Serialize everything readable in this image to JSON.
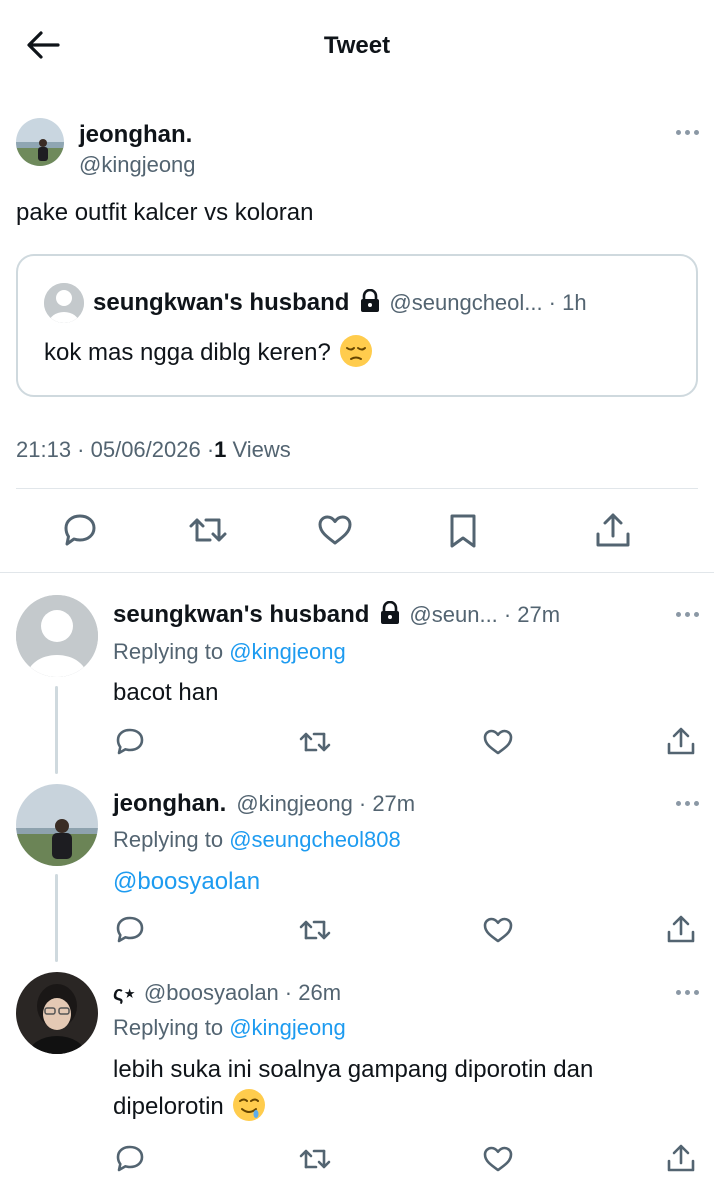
{
  "header": {
    "title": "Tweet"
  },
  "main_tweet": {
    "name": "jeonghan.",
    "handle": "@kingjeong",
    "text": "pake outfit kalcer vs koloran",
    "quote": {
      "name": "seungkwan's husband",
      "handle": "@seungcheol...",
      "time": "· 1h",
      "text": "kok mas ngga diblg keren?",
      "emoji": "pensive-face"
    },
    "timestamp": "21:13 · 05/06/2026 · ",
    "views_count": "1",
    "views_label": " Views"
  },
  "replies": [
    {
      "name": "seungkwan's husband",
      "handle": "@seun...",
      "time": "· 27m",
      "replying_prefix": "Replying to ",
      "replying_to": "@kingjeong",
      "text": "bacot han",
      "locked": true
    },
    {
      "name": "jeonghan.",
      "handle": "@kingjeong",
      "time": "· 27m",
      "replying_prefix": "Replying to ",
      "replying_to": "@seungcheol808",
      "text": "@boosyaolan",
      "locked": false
    },
    {
      "name": "ς⋆",
      "handle": "@boosyaolan",
      "time": "· 26m",
      "replying_prefix": "Replying to ",
      "replying_to": "@kingjeong",
      "text_line1": "lebih suka ini soalnya gampang diporotin dan",
      "text_line2": "dipelorotin",
      "emoji": "drooling-face",
      "locked": false
    }
  ],
  "icons": [
    "back-arrow-icon",
    "more-icon",
    "lock-icon",
    "reply-icon",
    "retweet-icon",
    "like-icon",
    "bookmark-icon",
    "share-icon"
  ],
  "colors": {
    "link": "#1d9bf0",
    "muted": "#536471",
    "text": "#0f1419",
    "border": "#cfd9de"
  }
}
